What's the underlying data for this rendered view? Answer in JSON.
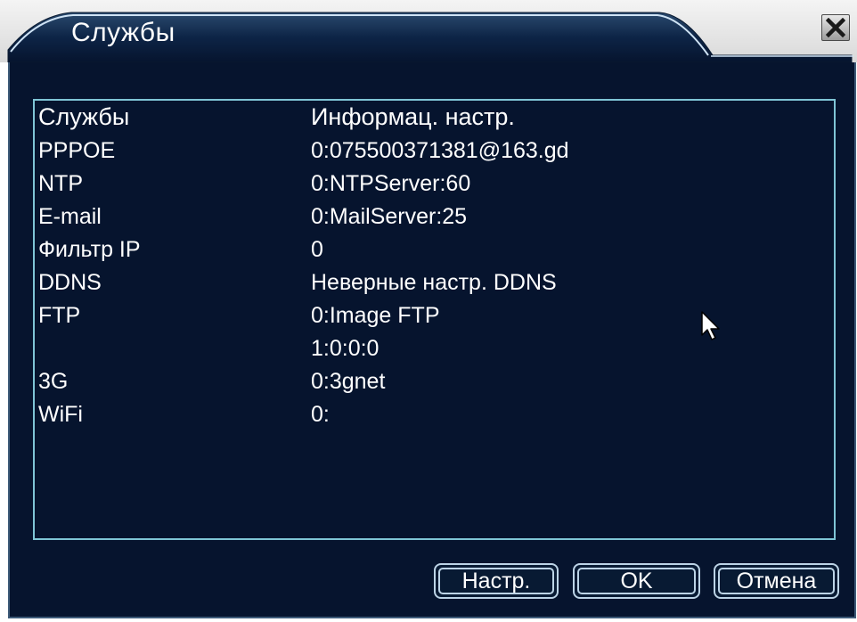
{
  "window": {
    "title": "Службы",
    "close_icon": "close-x-icon"
  },
  "table": {
    "header": {
      "name": "Службы",
      "value": "Информац. настр."
    },
    "rows": [
      {
        "name": "PPPOE",
        "value": "0:075500371381@163.gd"
      },
      {
        "name": "NTP",
        "value": "0:NTPServer:60"
      },
      {
        "name": "E-mail",
        "value": "0:MailServer:25"
      },
      {
        "name": "Фильтр IP",
        "value": "0"
      },
      {
        "name": "DDNS",
        "value": "Неверные настр. DDNS"
      },
      {
        "name": "FTP",
        "value": "0:Image FTP"
      },
      {
        "name": "",
        "value": "1:0:0:0"
      },
      {
        "name": "3G",
        "value": "0:3gnet"
      },
      {
        "name": "WiFi",
        "value": "0:"
      }
    ]
  },
  "buttons": {
    "setup": "Настр.",
    "ok": "OK",
    "cancel": "Отмена"
  },
  "colors": {
    "panel_bg": "#06142e",
    "border_accent": "#7fc5d6",
    "text": "#ffffff"
  },
  "cursor_icon": "mouse-pointer-icon"
}
